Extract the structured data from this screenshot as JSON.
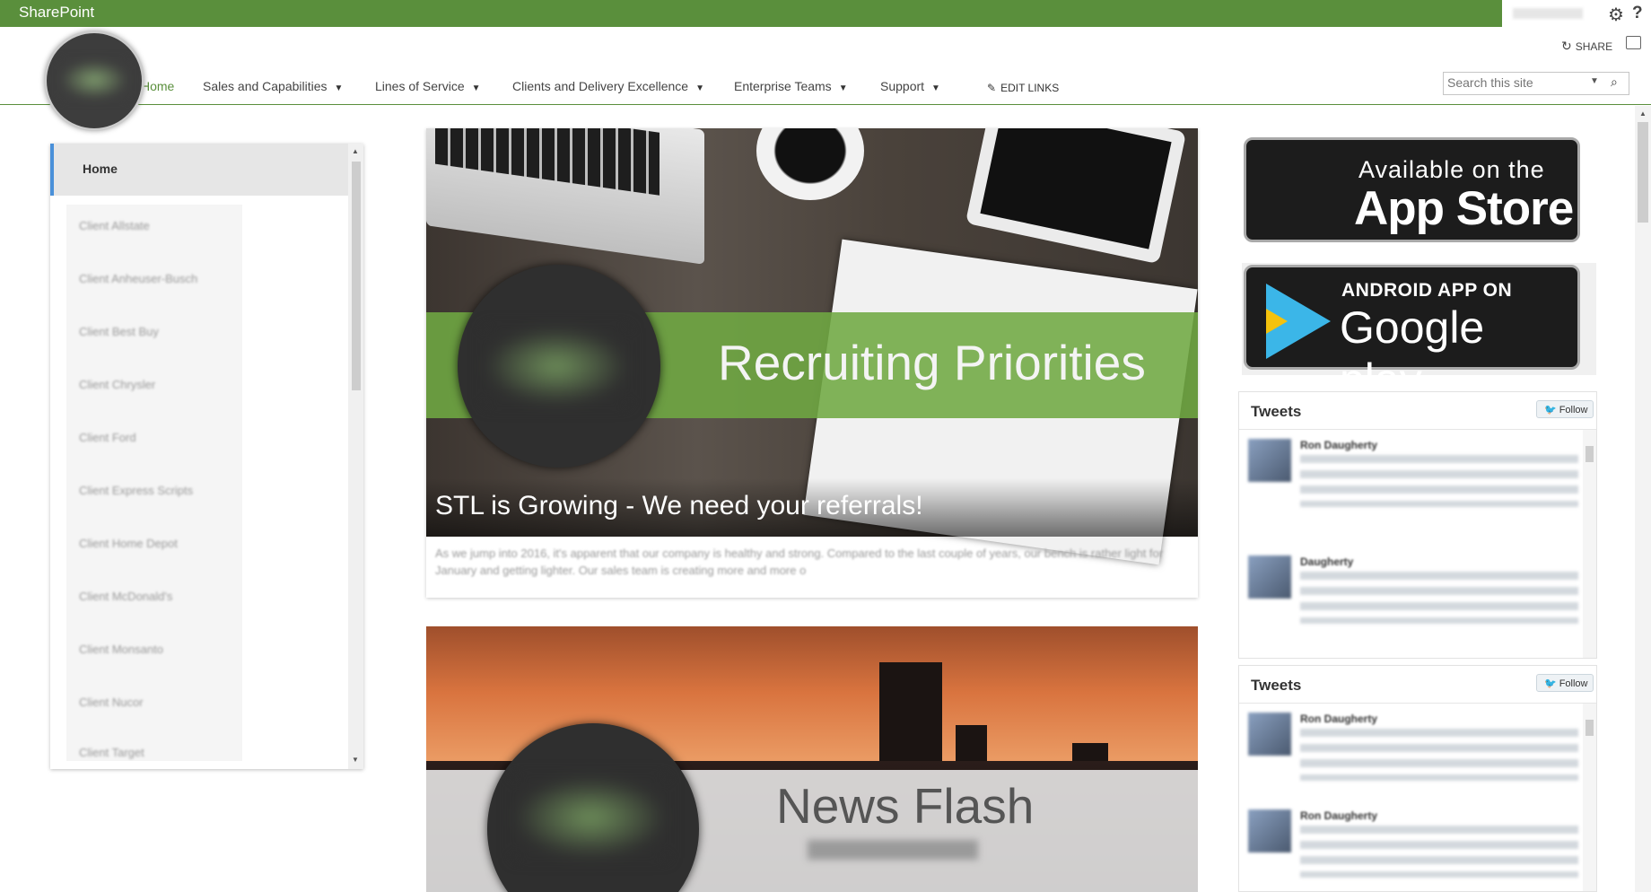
{
  "suitebar": {
    "brand": "SharePoint",
    "user_name": "",
    "settings_icon": "gear-icon",
    "help_icon": "help-icon",
    "help_glyph": "?",
    "settings_glyph": "⚙"
  },
  "ribbon": {
    "share_label": "SHARE",
    "focus_icon": "focus-on-content-icon"
  },
  "nav": {
    "items": [
      {
        "label": "Home",
        "has_dropdown": false,
        "active": true
      },
      {
        "label": "Sales and Capabilities",
        "has_dropdown": true
      },
      {
        "label": "Lines of Service",
        "has_dropdown": true
      },
      {
        "label": "Clients and Delivery Excellence",
        "has_dropdown": true
      },
      {
        "label": "Enterprise Teams",
        "has_dropdown": true
      },
      {
        "label": "Support",
        "has_dropdown": true
      }
    ],
    "edit_links": "EDIT LINKS",
    "caret": "▼"
  },
  "search": {
    "placeholder": "Search this site",
    "dropdown_glyph": "▼",
    "search_glyph": "⌕"
  },
  "quick_launch": {
    "home": "Home",
    "items": [
      "Client Allstate",
      "Client Anheuser-Busch",
      "Client Best Buy",
      "Client Chrysler",
      "Client Ford",
      "Client Express Scripts",
      "Client Home Depot",
      "Client McDonald's",
      "Client Monsanto",
      "Client Nucor",
      "Client Target"
    ]
  },
  "news": {
    "card1": {
      "banner": "Recruiting Priorities",
      "headline": "STL is Growing - We need your referrals!",
      "excerpt": "As we jump into 2016, it's apparent that our company is healthy and strong. Compared to the last couple of years, our bench is rather light for January and getting lighter. Our sales team is creating more and more o"
    },
    "card2": {
      "banner": "News Flash"
    }
  },
  "apps": {
    "appstore_line1": "Available on the",
    "appstore_line2": "App Store",
    "apple_glyph": "",
    "android_line1": "ANDROID APP ON",
    "android_line2": "Google play"
  },
  "tweets": [
    {
      "title": "Tweets",
      "follow": "Follow",
      "items": [
        {
          "name": "Ron Daugherty"
        },
        {
          "name": "Daugherty"
        }
      ]
    },
    {
      "title": "Tweets",
      "follow": "Follow",
      "items": [
        {
          "name": "Ron Daugherty"
        },
        {
          "name": "Ron Daugherty"
        }
      ]
    }
  ],
  "colors": {
    "brand_green": "#5a8f3c",
    "active_blue": "#4a90d9"
  }
}
